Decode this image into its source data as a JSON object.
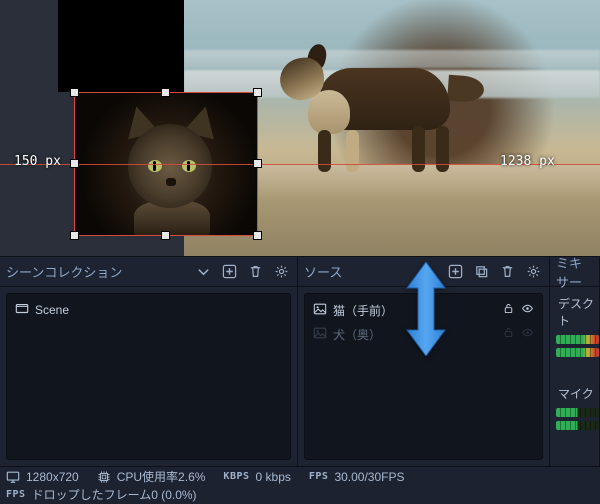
{
  "preview": {
    "dim_left": "150 px",
    "dim_right": "1238 px"
  },
  "panels": {
    "scenes": {
      "title": "シーンコレクション",
      "items": [
        {
          "label": "Scene"
        }
      ]
    },
    "sources": {
      "title": "ソース",
      "items": [
        {
          "label": "猫（手前）",
          "locked": false,
          "visible": true,
          "active": true
        },
        {
          "label": "犬（奥）",
          "locked": false,
          "visible": true,
          "active": false
        }
      ]
    },
    "mixer": {
      "title": "ミキサー",
      "tracks": [
        {
          "label": "デスクト"
        },
        {
          "label": "マイク"
        }
      ]
    }
  },
  "status": {
    "resolution": "1280x720",
    "cpu": "CPU使用率2.6%",
    "kbps_label": "KBPS",
    "kbps_value": "0 kbps",
    "fps_label": "FPS",
    "fps_value": "30.00/30FPS",
    "dropped_label": "FPS",
    "dropped": "ドロップしたフレーム0 (0.0%)"
  }
}
